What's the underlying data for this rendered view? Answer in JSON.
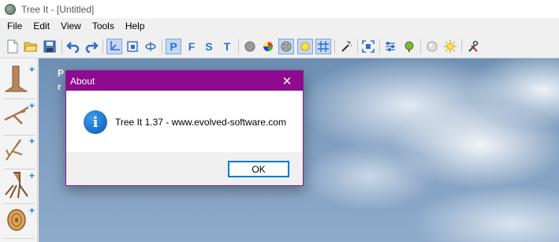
{
  "window": {
    "title": "Tree It - [Untitled]"
  },
  "menu": {
    "items": [
      "File",
      "Edit",
      "View",
      "Tools",
      "Help"
    ]
  },
  "toolbar": {
    "view_modes": [
      "P",
      "F",
      "S",
      "T"
    ],
    "icons": [
      "new-file",
      "open-folder",
      "save",
      "undo",
      "redo",
      "axis",
      "frame-select",
      "rotate",
      "perspective-view",
      "front-view",
      "side-view",
      "top-view",
      "sphere-gray",
      "color-wheel",
      "sphere-texture",
      "sun-light",
      "grid",
      "magic-wand",
      "screenshot",
      "sliders",
      "tree-leaf",
      "sphere-white",
      "sun",
      "tools-settings"
    ],
    "active_view": "P"
  },
  "left_panel": {
    "items": [
      "trunk-tool",
      "branch-tool",
      "twig-tool",
      "root-tool",
      "log-tool"
    ]
  },
  "viewport": {
    "overlay_line1": "P",
    "overlay_line2": "r"
  },
  "dialog": {
    "title": "About",
    "message": "Tree It 1.37 - www.evolved-software.com",
    "ok_label": "OK",
    "info_glyph": "i",
    "close_glyph": "✕"
  },
  "colors": {
    "dialog_accent": "#8e0a8e",
    "button_focus": "#0078d4",
    "toolbar_letter": "#2c6fcc"
  }
}
